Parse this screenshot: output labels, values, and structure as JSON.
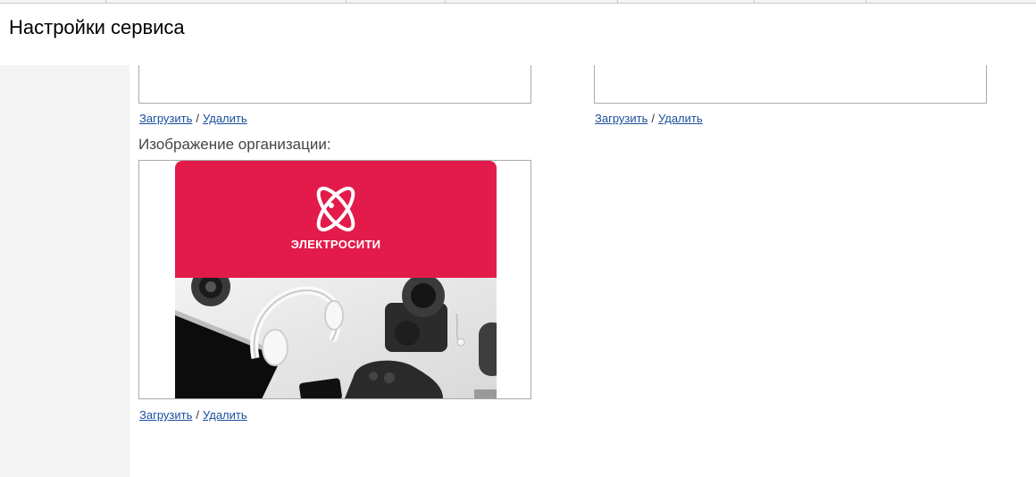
{
  "page": {
    "title": "Настройки сервиса"
  },
  "upload_blocks": [
    {
      "upload_label": "Загрузить",
      "separator": "/",
      "delete_label": "Удалить"
    },
    {
      "upload_label": "Загрузить",
      "separator": "/",
      "delete_label": "Удалить"
    }
  ],
  "organization_image": {
    "label": "Изображение организации:",
    "brand_text": "ЭЛЕКТРОСИТИ",
    "brand_color": "#e21b4b",
    "upload_label": "Загрузить",
    "separator": "/",
    "delete_label": "Удалить"
  },
  "colors": {
    "link": "#1a4f9c",
    "sidebar": "#f3f3f3",
    "border": "#a9a9a9"
  }
}
